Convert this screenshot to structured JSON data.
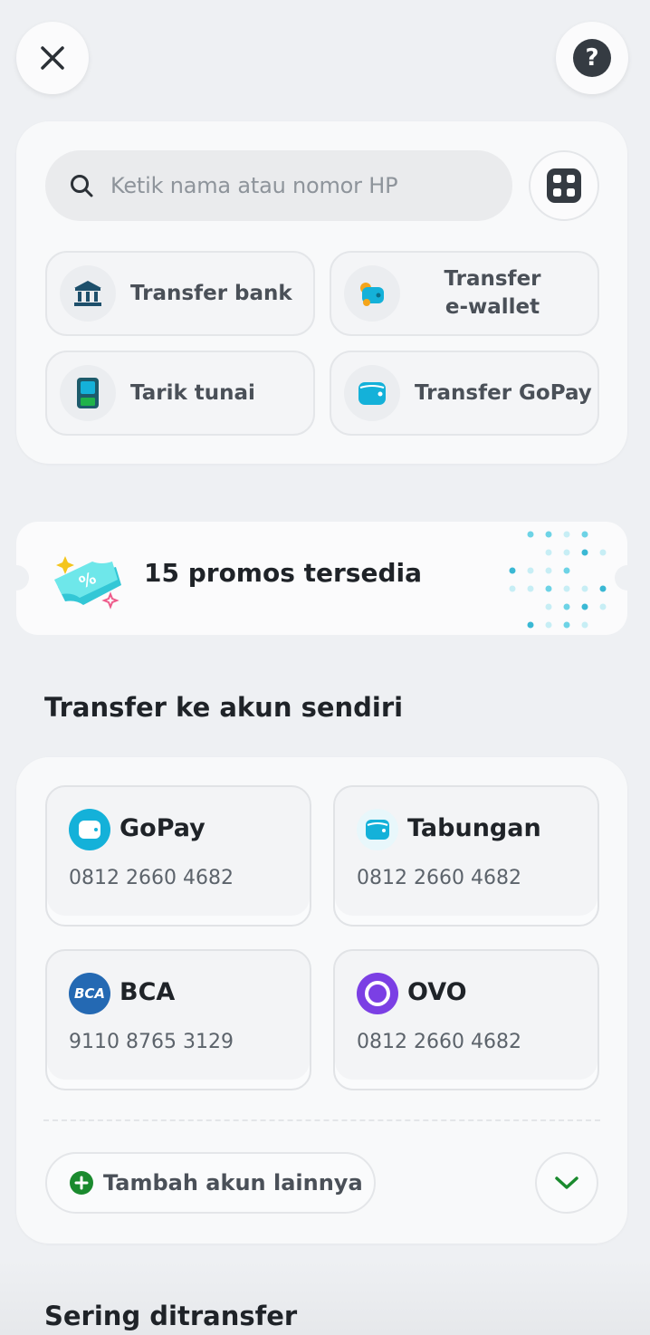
{
  "search": {
    "placeholder": "Ketik nama atau nomor HP"
  },
  "quick_actions": [
    {
      "label": "Transfer bank",
      "icon": "bank-icon"
    },
    {
      "label": "Transfer\ne-wallet",
      "icon": "wallet-icon"
    },
    {
      "label": "Tarik tunai",
      "icon": "atm-icon"
    },
    {
      "label": "Transfer GoPay",
      "icon": "gopay-icon"
    }
  ],
  "promo": {
    "text": "15 promos tersedia"
  },
  "own_accounts": {
    "title": "Transfer ke akun sendiri",
    "items": [
      {
        "name": "GoPay",
        "number": "0812 2660 4682",
        "icon": "gopay-icon"
      },
      {
        "name": "Tabungan",
        "number": "0812 2660 4682",
        "icon": "savings-icon"
      },
      {
        "name": "BCA",
        "number": "9110 8765 3129",
        "icon": "bca-logo",
        "logo_text": "BCA"
      },
      {
        "name": "OVO",
        "number": "0812 2660 4682",
        "icon": "ovo-logo"
      }
    ],
    "add_label": "Tambah akun lainnya"
  },
  "frequent": {
    "title": "Sering ditransfer"
  },
  "colors": {
    "accent_green": "#1a8a2e",
    "gopay_blue": "#14b1d9",
    "bca_blue": "#2469b3",
    "ovo_purple": "#7b3fe4"
  }
}
